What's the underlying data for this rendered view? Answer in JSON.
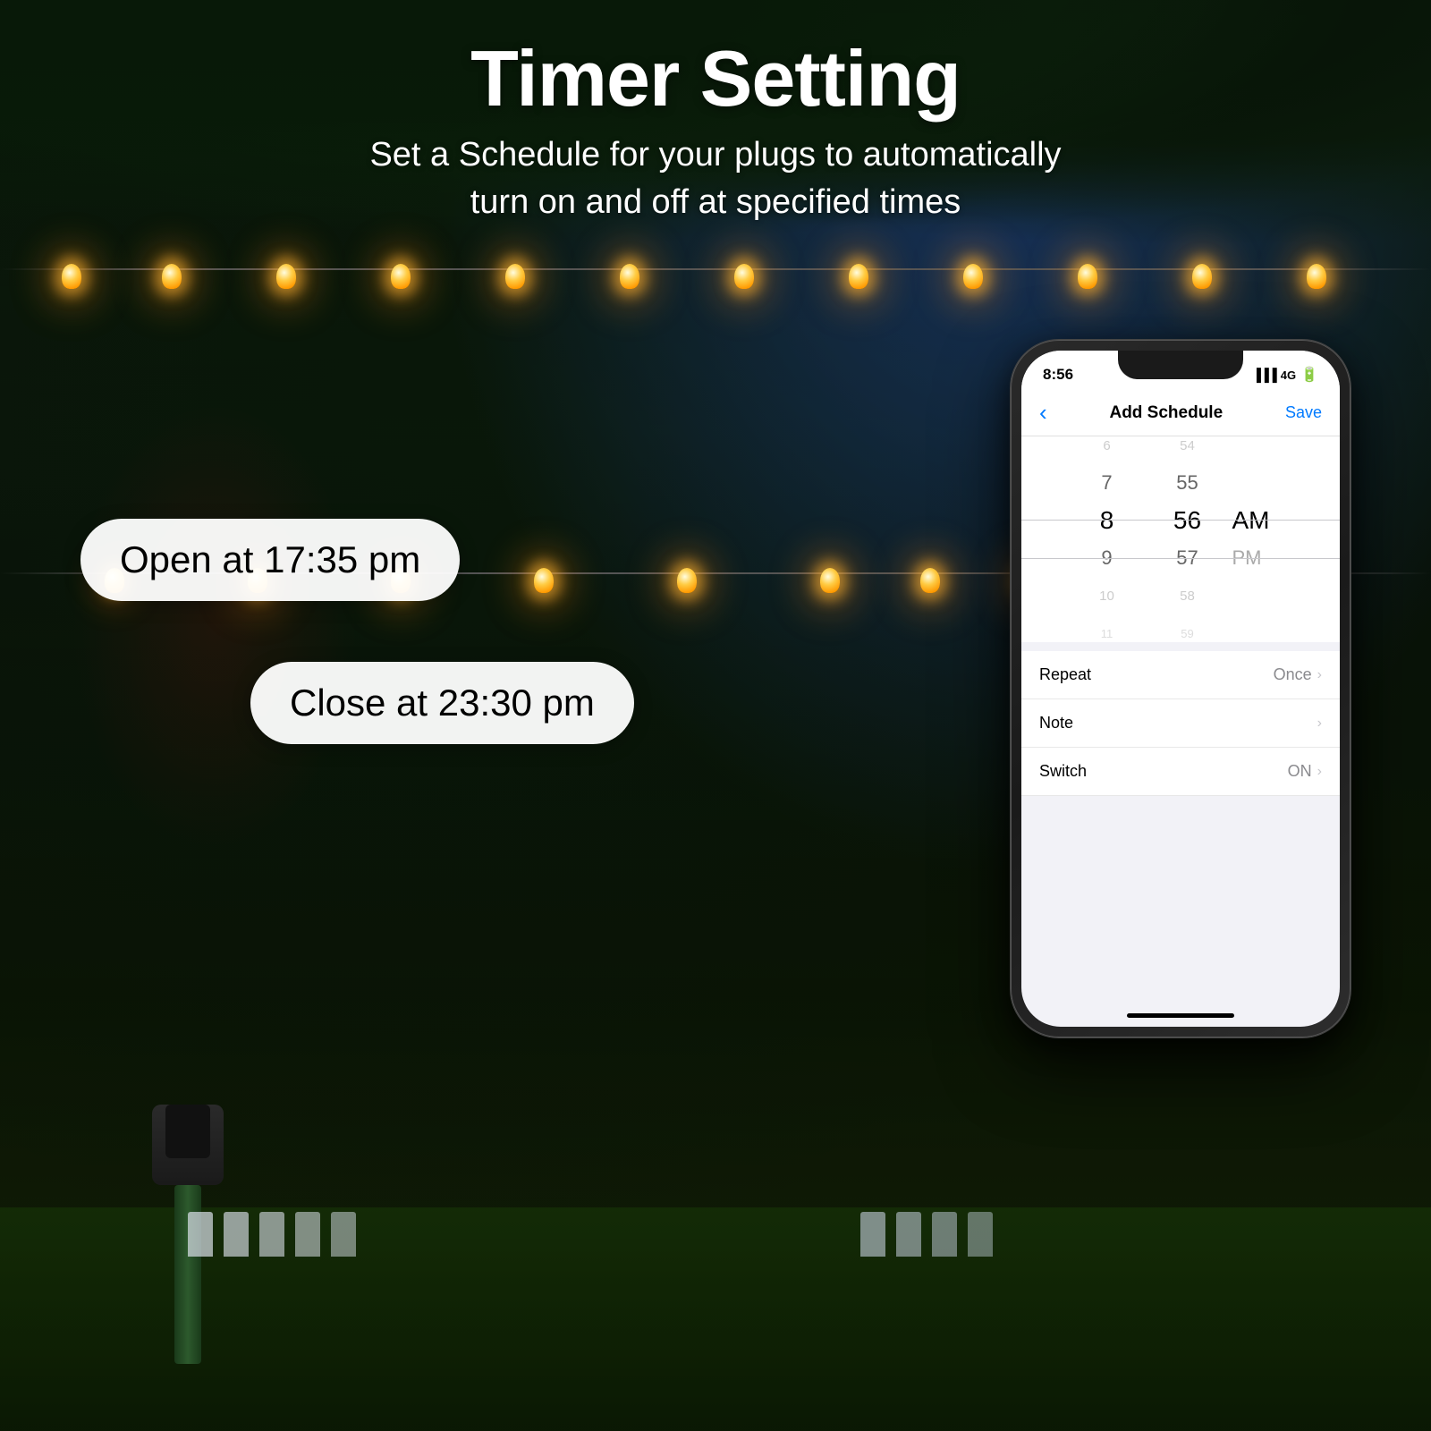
{
  "page": {
    "background": {
      "description": "Outdoor night scene with string lights and decorated trees"
    }
  },
  "header": {
    "title": "Timer Setting",
    "subtitle_line1": "Set a Schedule for your plugs to automatically",
    "subtitle_line2": "turn on and off at specified times"
  },
  "bubbles": {
    "open": "Open at 17:35 pm",
    "close": "Close at 23:30 pm"
  },
  "phone": {
    "status_bar": {
      "time": "8:56",
      "signal": "4G"
    },
    "app_header": {
      "back_label": "‹",
      "title": "Add Schedule",
      "save_label": "Save"
    },
    "time_picker": {
      "hours": [
        "6",
        "7",
        "8",
        "9",
        "10",
        "11"
      ],
      "minutes": [
        "54",
        "55",
        "56",
        "57",
        "58",
        "59"
      ],
      "selected_hour": "8",
      "selected_minute": "56",
      "ampm_options": [
        "AM",
        "PM"
      ],
      "selected_ampm": "AM"
    },
    "settings_rows": [
      {
        "label": "Repeat",
        "value": "Once",
        "has_chevron": true
      },
      {
        "label": "Note",
        "value": "",
        "has_chevron": true
      },
      {
        "label": "Switch",
        "value": "ON",
        "has_chevron": true
      }
    ],
    "home_indicator": true
  },
  "string_lights": {
    "bulb_positions": [
      5,
      12,
      20,
      28,
      36,
      44,
      52,
      60,
      68,
      76,
      84,
      92
    ]
  }
}
